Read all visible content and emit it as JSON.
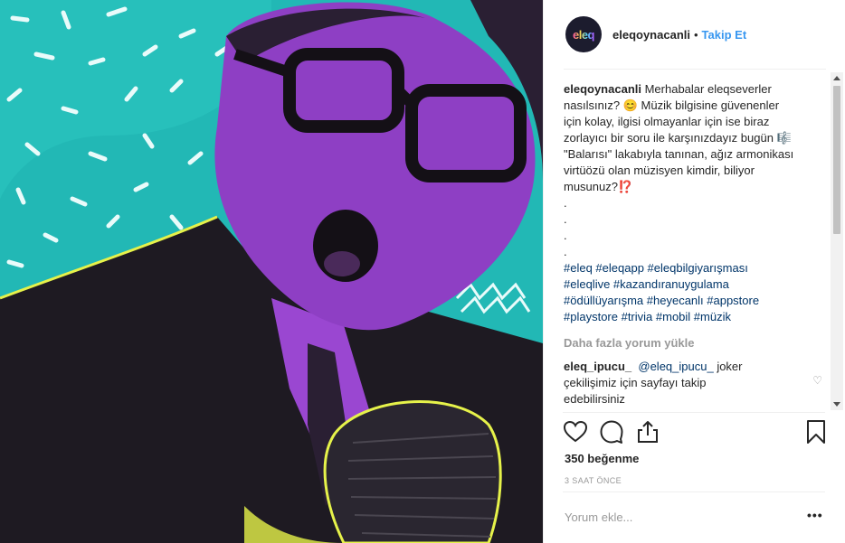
{
  "post": {
    "username": "eleqoynacanli",
    "separator": "•",
    "follow_label": "Takip Et",
    "avatar_text": "eleq"
  },
  "caption": {
    "username": "eleqoynacanli",
    "text_lines": [
      " Merhabalar eleqseverler",
      "nasılsınız? 😊 Müzik bilgisine güvenenler",
      "için kolay, ilgisi olmayanlar için ise biraz",
      "zorlayıcı bir soru ile karşınızdayız bugün 🎼",
      "\"Balarısı\" lakabıyla tanınan, ağız armonikası",
      "virtüözü olan müzisyen kimdir, biliyor",
      "musunuz?⁉️"
    ],
    "dots": [
      ".",
      ".",
      ".",
      "."
    ],
    "hashtag_lines": [
      "#eleq #eleqapp #eleqbilgiyarışması",
      "#eleqlive #kazandıranuygulama",
      "#ödüllüyarışma #heyecanlı #appstore",
      "#playstore #trivia #mobil #müzik"
    ]
  },
  "load_more": "Daha fazla yorum yükle",
  "comment": {
    "username": "eleq_ipucu_",
    "mention": "@eleq_ipucu_",
    "text_1": " joker",
    "text_2": "çekilişimiz için sayfayı takip",
    "text_3": "edebilirsiniz"
  },
  "likes": "350 beğenme",
  "timestamp": "3 SAAT ÖNCE",
  "comment_input": {
    "placeholder": "Yorum ekle..."
  },
  "more_options": "•••",
  "icons": {
    "like": "heart-icon",
    "comment": "comment-icon",
    "share": "share-icon",
    "save": "bookmark-icon",
    "comment_like": "small-heart-icon"
  },
  "colors": {
    "background_teal": "#22b8b5",
    "purple": "#8e3fc4",
    "link": "#3897f0",
    "hashtag": "#003569"
  }
}
